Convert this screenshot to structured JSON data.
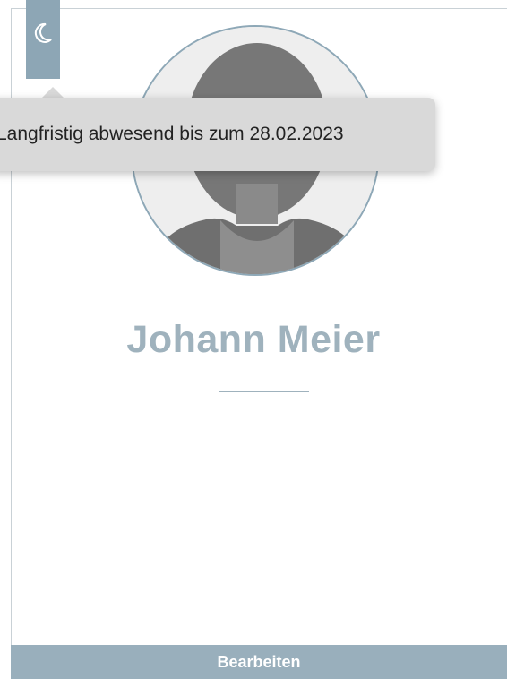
{
  "status": {
    "icon": "moon-icon",
    "tooltip_text": "Langfristig abwesend bis zum 28.02.2023"
  },
  "profile": {
    "name": "Johann Meier",
    "avatar": "user-avatar-placeholder"
  },
  "actions": {
    "edit_label": "Bearbeiten"
  },
  "colors": {
    "accent": "#8da6b5",
    "name_text": "#9fb2bd",
    "button_bg": "#99afbc",
    "tooltip_bg": "#d9d9d9"
  }
}
